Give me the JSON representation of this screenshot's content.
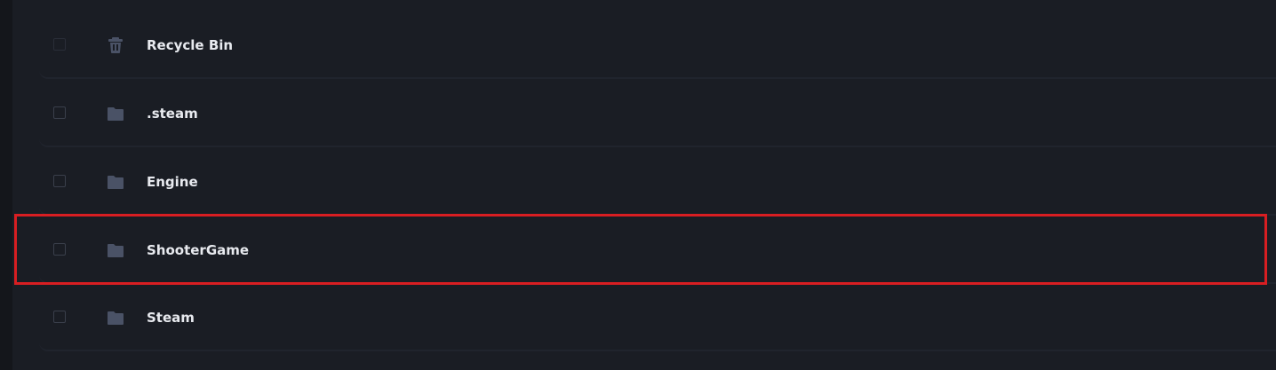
{
  "files": [
    {
      "name": "Recycle Bin",
      "icon": "trash-icon"
    },
    {
      "name": ".steam",
      "icon": "folder-icon"
    },
    {
      "name": "Engine",
      "icon": "folder-icon"
    },
    {
      "name": "ShooterGame",
      "icon": "folder-icon"
    },
    {
      "name": "Steam",
      "icon": "folder-icon"
    }
  ],
  "highlighted_row": "ShooterGame",
  "colors": {
    "background": "#1a1d24",
    "icon": "#4a5266",
    "text": "#e8eaef",
    "highlight": "#d81e22"
  }
}
